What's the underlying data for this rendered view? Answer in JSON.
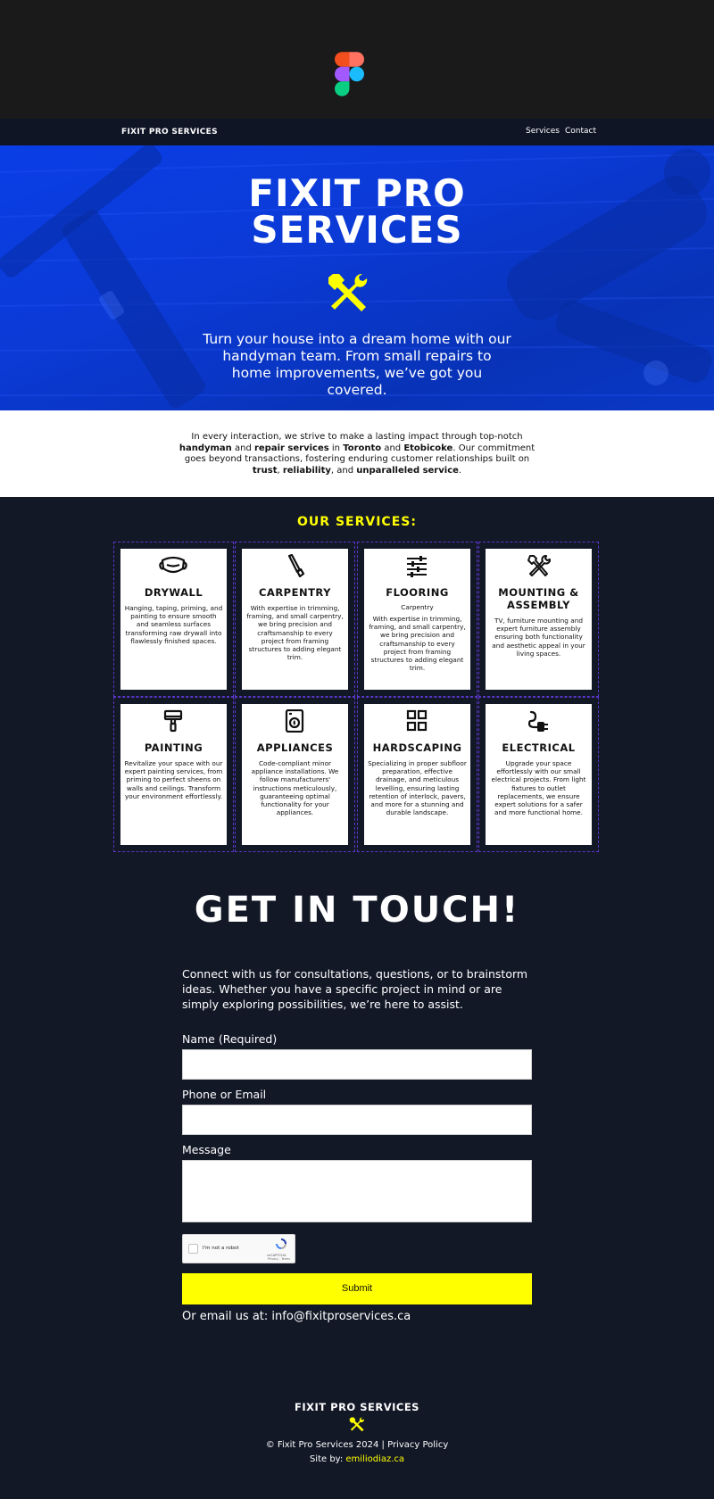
{
  "nav": {
    "brand": "FIXIT PRO SERVICES",
    "links": [
      "Services",
      "Contact"
    ]
  },
  "hero": {
    "title": "FIXIT PRO SERVICES",
    "subtitle": "Turn your house into a dream home with our handyman team. From small repairs to home improvements, we’ve got you covered.",
    "icon": "hammer-wrench-icon"
  },
  "intro": {
    "t1": "In every interaction, we strive to make a lasting impact through top-notch ",
    "b1": "handyman",
    "t2": " and ",
    "b2": "repair services",
    "t3": " in ",
    "b3": "Toronto",
    "t4": " and ",
    "b4": "Etobicoke",
    "t5": ". Our commitment goes beyond transactions, fostering enduring customer relationships built on ",
    "b5": "trust",
    "t6": ", ",
    "b6": "reliability",
    "t7": ", and ",
    "b7": "unparalleled service",
    "t8": "."
  },
  "services": {
    "title": "OUR SERVICES:",
    "items": [
      {
        "title": "DRYWALL",
        "icon": "mask-icon",
        "desc": "Hanging, taping, priming, and painting to ensure smooth and seamless surfaces transforming raw drywall into flawlessly finished spaces."
      },
      {
        "title": "CARPENTRY",
        "icon": "saw-icon",
        "desc": "With expertise in trimming, framing, and small carpentry, we bring precision and craftsmanship to every project from framing structures to adding elegant trim."
      },
      {
        "title": "FLOORING",
        "icon": "sliders-icon",
        "subtitle": "Carpentry",
        "desc": "With expertise in trimming, framing, and small carpentry, we bring precision and craftsmanship to every project from framing structures to adding elegant trim."
      },
      {
        "title": "MOUNTING & ASSEMBLY",
        "icon": "hammer-wrench-icon",
        "desc": "TV, furniture mounting and expert furniture assembly ensuring both functionality and aesthetic appeal in your living spaces."
      },
      {
        "title": "PAINTING",
        "icon": "paint-roller-icon",
        "desc": "Revitalize your space with our expert painting services, from priming to perfect sheens on walls and ceilings. Transform your environment effortlessly."
      },
      {
        "title": "APPLIANCES",
        "icon": "washing-machine-icon",
        "desc": "Code-compliant minor appliance installations. We follow manufacturers' instructions meticulously, guaranteeing optimal functionality for your appliances."
      },
      {
        "title": "HARDSCAPING",
        "icon": "grid-icon",
        "desc": "Specializing in proper subfloor preparation, effective drainage, and meticulous levelling, ensuring lasting retention of interlock, pavers, and more for a stunning and durable landscape."
      },
      {
        "title": "ELECTRICAL",
        "icon": "plug-icon",
        "desc": "Upgrade your space effortlessly with our small electrical projects. From light fixtures to outlet replacements, we ensure expert solutions for a safer and more functional home."
      }
    ]
  },
  "contact": {
    "title": "GET IN TOUCH!",
    "text": "Connect with us for consultations, questions, or to brainstorm ideas. Whether you have a specific project in mind or are simply exploring possibilities, we’re here to assist.",
    "name_label": "Name (Required)",
    "phone_label": "Phone or Email",
    "message_label": "Message",
    "captcha_label": "I'm not a robot",
    "captcha_brand": "reCAPTCHA",
    "captcha_links": "Privacy - Terms",
    "submit": "Submit",
    "email_line": "Or email us at: info@fixitproservices.ca"
  },
  "footer": {
    "brand": "FIXIT PRO SERVICES",
    "copyright": "© Fixit Pro Services 2024 | Privacy Policy",
    "site_prefix": "Site by: ",
    "site_link": "emiliodiaz.ca"
  },
  "colors": {
    "accent": "#ffff00",
    "background": "#131827",
    "hero_blue": "#0a3ee6",
    "grid_border": "#5b35c8"
  }
}
